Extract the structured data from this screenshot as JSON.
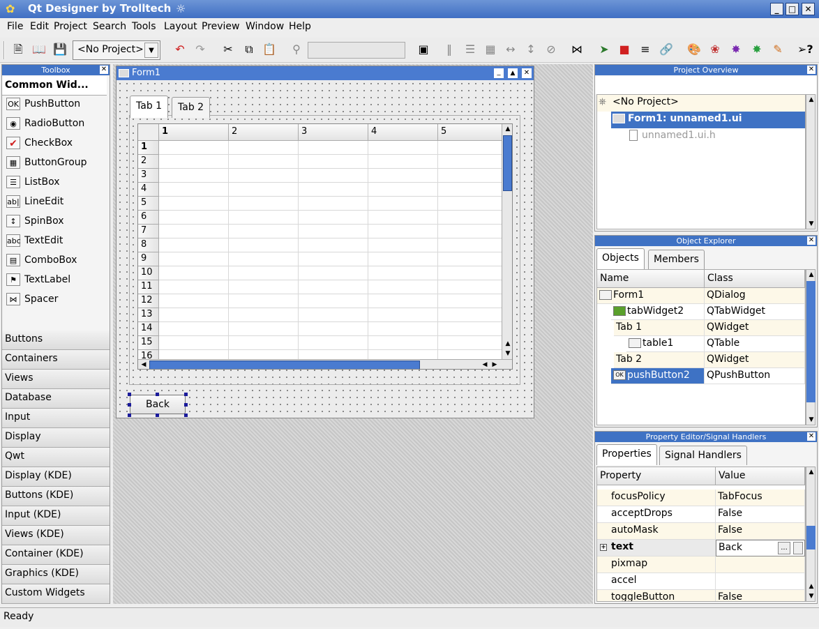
{
  "window": {
    "title": "Qt Designer by Trolltech"
  },
  "menu": [
    "File",
    "Edit",
    "Project",
    "Search",
    "Tools",
    "Layout",
    "Preview",
    "Window",
    "Help"
  ],
  "toolbar": {
    "project_combo": "<No Project>"
  },
  "toolbox": {
    "title": "Toolbox",
    "section_title": "Common Wid...",
    "items": [
      "PushButton",
      "RadioButton",
      "CheckBox",
      "ButtonGroup",
      "ListBox",
      "LineEdit",
      "SpinBox",
      "TextEdit",
      "ComboBox",
      "TextLabel",
      "Spacer"
    ],
    "sections": [
      "Buttons",
      "Containers",
      "Views",
      "Database",
      "Input",
      "Display",
      "Qwt",
      "Display (KDE)",
      "Buttons (KDE)",
      "Input (KDE)",
      "Views (KDE)",
      "Container (KDE)",
      "Graphics (KDE)",
      "Custom Widgets"
    ]
  },
  "form": {
    "title": "Form1",
    "tabs": [
      "Tab 1",
      "Tab 2"
    ],
    "columns": [
      "1",
      "2",
      "3",
      "4",
      "5"
    ],
    "rows": [
      "1",
      "2",
      "3",
      "4",
      "5",
      "6",
      "7",
      "8",
      "9",
      "10",
      "11",
      "12",
      "13",
      "14",
      "15",
      "16"
    ],
    "back_button": "Back"
  },
  "project_overview": {
    "title": "Project Overview",
    "items": [
      "<No Project>",
      "Form1: unnamed1.ui",
      "unnamed1.ui.h"
    ]
  },
  "object_explorer": {
    "title": "Object Explorer",
    "tabs": [
      "Objects",
      "Members"
    ],
    "headers": [
      "Name",
      "Class"
    ],
    "rows": [
      {
        "name": "Form1",
        "class": "QDialog"
      },
      {
        "name": "tabWidget2",
        "class": "QTabWidget"
      },
      {
        "name": "Tab 1",
        "class": "QWidget"
      },
      {
        "name": "table1",
        "class": "QTable"
      },
      {
        "name": "Tab 2",
        "class": "QWidget"
      },
      {
        "name": "pushButton2",
        "class": "QPushButton"
      }
    ]
  },
  "property_editor": {
    "title": "Property Editor/Signal Handlers",
    "tabs": [
      "Properties",
      "Signal Handlers"
    ],
    "headers": [
      "Property",
      "Value"
    ],
    "rows": [
      {
        "prop": "focusPolicy",
        "value": "TabFocus"
      },
      {
        "prop": "acceptDrops",
        "value": "False"
      },
      {
        "prop": "autoMask",
        "value": "False"
      },
      {
        "prop": "text",
        "value": "Back"
      },
      {
        "prop": "pixmap",
        "value": ""
      },
      {
        "prop": "accel",
        "value": ""
      },
      {
        "prop": "toggleButton",
        "value": "False"
      }
    ]
  },
  "status": "Ready"
}
